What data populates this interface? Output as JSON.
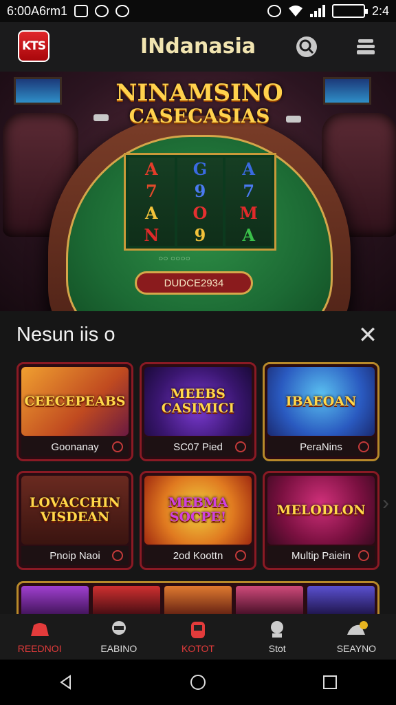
{
  "status_bar": {
    "left_text": "6:00A6rm1",
    "right_text": "2:4"
  },
  "header": {
    "title": "INdanasia",
    "logo_text": "KTS"
  },
  "hero": {
    "title_line1": "NINAMSINO",
    "title_line2": "CASECASIAS",
    "reel_symbols": [
      [
        "A",
        "7",
        "A",
        "N"
      ],
      [
        "G",
        "9",
        "O",
        "9"
      ],
      [
        "A",
        "7",
        "M",
        "A"
      ]
    ],
    "pill_text": "DUDCE2934",
    "felt_text": "○○ ○○○○"
  },
  "panel": {
    "title": "Nesun iis o",
    "close_label": "✕",
    "cards": [
      {
        "art": "CEECEPEABS",
        "label": "Goonanay"
      },
      {
        "art": "MEEBS CASIMICI",
        "label": "SC07 Pied"
      },
      {
        "art": "IBAEOAN",
        "label": "PeraNins"
      },
      {
        "art": "LOVACCHIN VISDEAN",
        "label": "Pnoip Naoi"
      },
      {
        "art": "MEBMA SOCPE!",
        "label": "2od Koottn"
      },
      {
        "art": "MELODLON",
        "label": "Multip Paiein"
      }
    ]
  },
  "bottom_nav": [
    {
      "label": "REEDNOI",
      "active": true
    },
    {
      "label": "EABINO",
      "active": false
    },
    {
      "label": "KOTOT",
      "active": false
    },
    {
      "label": "Stot",
      "active": false
    },
    {
      "label": "SEAYNO",
      "active": false
    }
  ]
}
